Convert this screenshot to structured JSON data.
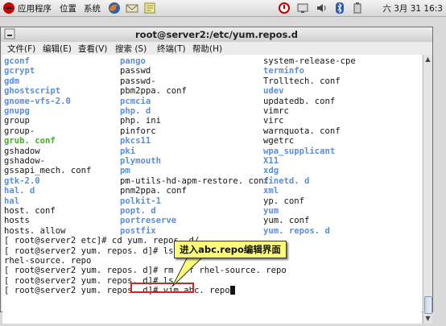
{
  "panel": {
    "menus": [
      "应用程序",
      "位置",
      "系统"
    ],
    "clock": "六 3月 31 16:3"
  },
  "window": {
    "title": "root@server2:/etc/yum.repos.d",
    "menubar": [
      "文件(F)",
      "编辑(E)",
      "查看(V)",
      "搜索 (S)",
      "终端(T)",
      "帮助(H)"
    ]
  },
  "listing": [
    [
      {
        "t": "gconf",
        "c": "blue"
      },
      {
        "t": "pango",
        "c": "blue"
      },
      {
        "t": "system-release-cpe",
        "c": "black"
      }
    ],
    [
      {
        "t": "gcrypt",
        "c": "blue"
      },
      {
        "t": "passwd",
        "c": "black"
      },
      {
        "t": "terminfo",
        "c": "blue"
      }
    ],
    [
      {
        "t": "gdm",
        "c": "blue"
      },
      {
        "t": "passwd-",
        "c": "black"
      },
      {
        "t": "Trolltech. conf",
        "c": "black"
      }
    ],
    [
      {
        "t": "ghostscript",
        "c": "blue"
      },
      {
        "t": "pbm2ppa. conf",
        "c": "black"
      },
      {
        "t": "udev",
        "c": "blue"
      }
    ],
    [
      {
        "t": "gnome-vfs-2.0",
        "c": "blue"
      },
      {
        "t": "pcmcia",
        "c": "blue"
      },
      {
        "t": "updatedb. conf",
        "c": "black"
      }
    ],
    [
      {
        "t": "gnupg",
        "c": "blue"
      },
      {
        "t": "php. d",
        "c": "blue"
      },
      {
        "t": "vimrc",
        "c": "black"
      }
    ],
    [
      {
        "t": "group",
        "c": "black"
      },
      {
        "t": "php. ini",
        "c": "black"
      },
      {
        "t": "virc",
        "c": "black"
      }
    ],
    [
      {
        "t": "group-",
        "c": "black"
      },
      {
        "t": "pinforc",
        "c": "black"
      },
      {
        "t": "warnquota. conf",
        "c": "black"
      }
    ],
    [
      {
        "t": "grub. conf",
        "c": "green"
      },
      {
        "t": "pkcs11",
        "c": "blue"
      },
      {
        "t": "wgetrc",
        "c": "black"
      }
    ],
    [
      {
        "t": "gshadow",
        "c": "black"
      },
      {
        "t": "pki",
        "c": "blue"
      },
      {
        "t": "wpa_supplicant",
        "c": "blue"
      }
    ],
    [
      {
        "t": "gshadow-",
        "c": "black"
      },
      {
        "t": "plymouth",
        "c": "blue"
      },
      {
        "t": "X11",
        "c": "blue"
      }
    ],
    [
      {
        "t": "gssapi_mech. conf",
        "c": "black"
      },
      {
        "t": "pm",
        "c": "blue"
      },
      {
        "t": "xdg",
        "c": "blue"
      }
    ],
    [
      {
        "t": "gtk-2.0",
        "c": "blue"
      },
      {
        "t": "pm-utils-hd-apm-restore. conf",
        "c": "black"
      },
      {
        "t": "xinetd. d",
        "c": "blue"
      }
    ],
    [
      {
        "t": "hal. d",
        "c": "blue"
      },
      {
        "t": "pnm2ppa. conf",
        "c": "black"
      },
      {
        "t": "xml",
        "c": "blue"
      }
    ],
    [
      {
        "t": "hal",
        "c": "blue"
      },
      {
        "t": "polkit-1",
        "c": "blue"
      },
      {
        "t": "yp. conf",
        "c": "black"
      }
    ],
    [
      {
        "t": "host. conf",
        "c": "black"
      },
      {
        "t": "popt. d",
        "c": "blue"
      },
      {
        "t": "yum",
        "c": "blue"
      }
    ],
    [
      {
        "t": "hosts",
        "c": "black"
      },
      {
        "t": "portreserve",
        "c": "blue"
      },
      {
        "t": "yum. conf",
        "c": "black"
      }
    ],
    [
      {
        "t": "hosts. allow",
        "c": "black"
      },
      {
        "t": "postfix",
        "c": "blue"
      },
      {
        "t": "yum. repos. d",
        "c": "blue"
      }
    ]
  ],
  "commands": [
    "[ root@server2 etc]# cd yum. repos. d/",
    "[ root@server2 yum. repos. d]# ls",
    "rhel-source. repo",
    "[ root@server2 yum. repos. d]# rm -rf rhel-source. repo",
    "[ root@server2 yum. repos. d]# ls",
    "[ root@server2 yum. repos. d]# "
  ],
  "last_command": "vim abc. repo",
  "annotation": "进入abc.repo编辑界面",
  "colors": {
    "dir": "#5b8ed6",
    "green": "#3fb21e",
    "highlight": "#e02020",
    "callout": "#fdfd7a"
  },
  "icons": [
    "redhat-icon",
    "firefox-icon",
    "mail-icon",
    "notes-icon",
    "network-icon",
    "volume-icon",
    "bluetooth-icon",
    "battery-icon"
  ]
}
